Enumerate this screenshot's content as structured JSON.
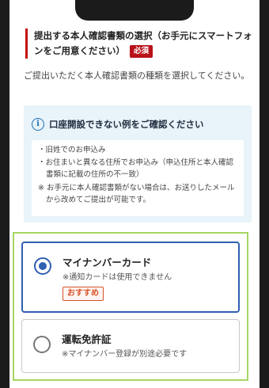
{
  "section": {
    "title": "提出する本人確認書類の選択（お手元にスマートフォンをご用意ください）",
    "required_badge": "必須",
    "description": "ご提出いただく本人確認書類の種類を選択してください。"
  },
  "info": {
    "heading": "口座開設できない例をご確認ください",
    "icon": "info-icon",
    "bullets": [
      "旧姓でのお申込み",
      "お住まいと異なる住所でお申込み（申込住所と本人確認書類に記載の住所の不一致）"
    ],
    "note": "※ お手元に本人確認書類がない場合は、お送りしたメールから改めてご提出が可能です。"
  },
  "options": [
    {
      "label": "マイナンバーカード",
      "note": "※通知カードは使用できません",
      "badge": "おすすめ",
      "selected": true
    },
    {
      "label": "運転免許証",
      "note": "※マイナンバー登録が別途必要です",
      "selected": false
    }
  ],
  "colors": {
    "accent_blue": "#2f5fb3",
    "required_red": "#b8121b",
    "recommend_orange": "#d8522a",
    "info_bg": "#e8f3fa",
    "highlight_green": "#a6d660"
  }
}
